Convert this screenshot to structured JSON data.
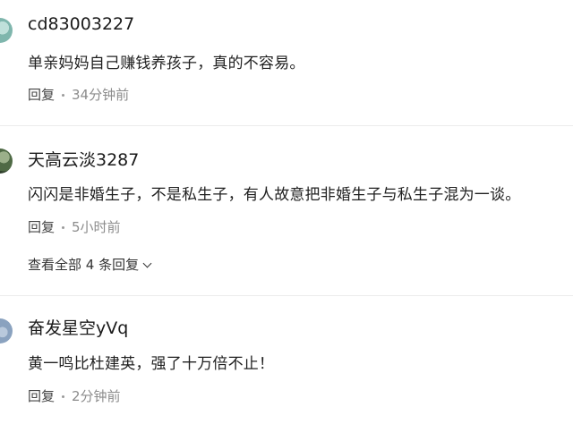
{
  "comments": [
    {
      "username": "cd83003227",
      "text": "单亲妈妈自己赚钱养孩子，真的不容易。",
      "reply_label": "回复",
      "time": "34分钟前"
    },
    {
      "username": "天高云淡3287",
      "text": "闪闪是非婚生子，不是私生子，有人故意把非婚生子与私生子混为一谈。",
      "reply_label": "回复",
      "time": "5小时前",
      "view_all_label": "查看全部 4 条回复"
    },
    {
      "username": "奋发星空yVq",
      "text": "黄一鸣比杜建英，强了十万倍不止！",
      "reply_label": "回复",
      "time": "2分钟前"
    }
  ]
}
